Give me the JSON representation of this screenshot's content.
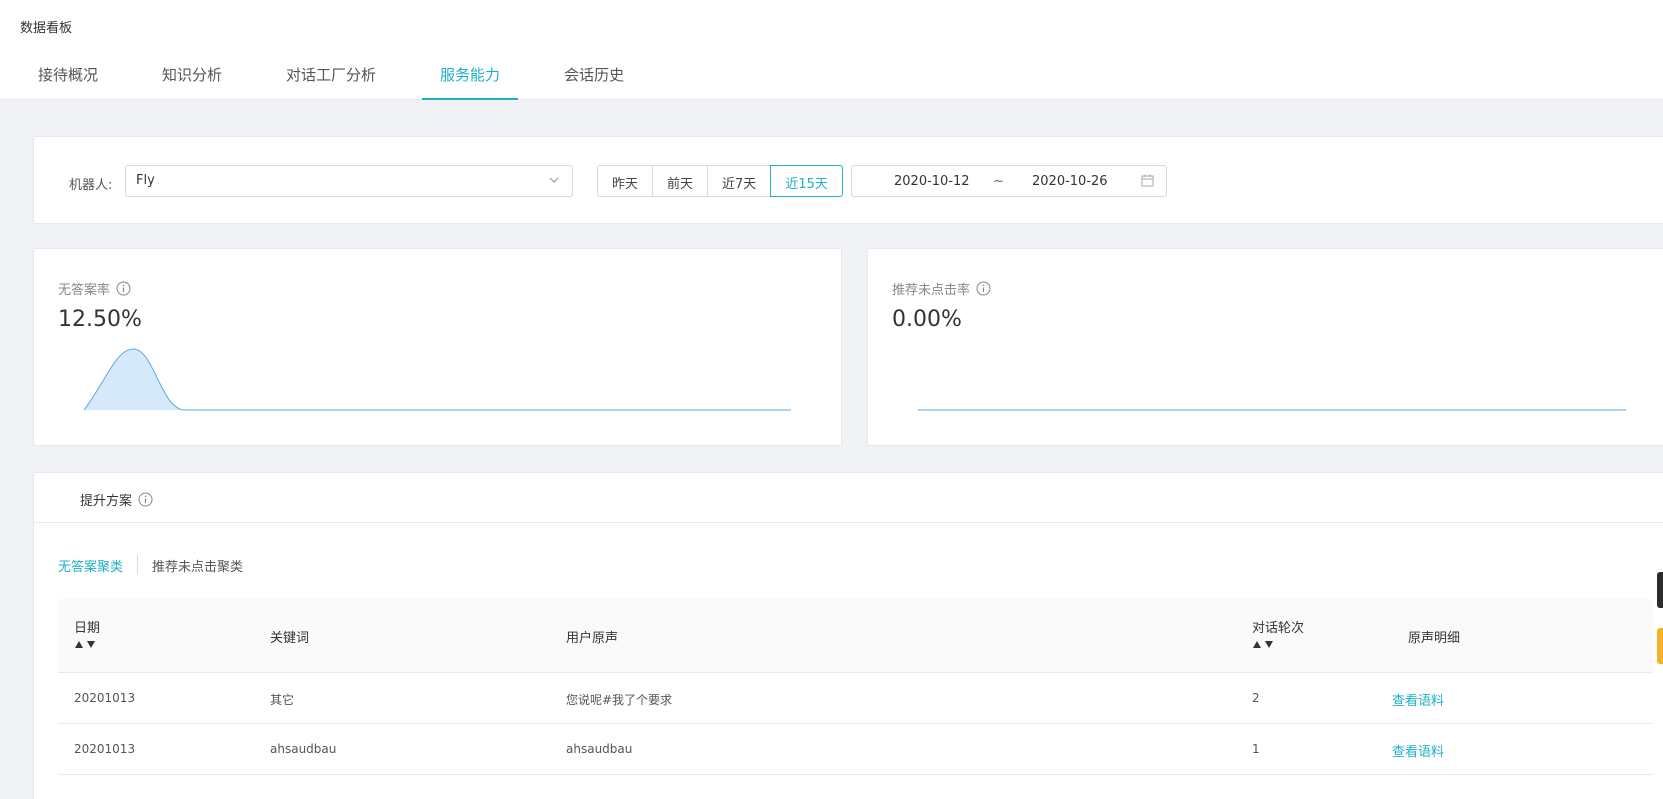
{
  "header": {
    "title": "数据看板",
    "tabs": [
      {
        "label": "接待概况",
        "active": false
      },
      {
        "label": "知识分析",
        "active": false
      },
      {
        "label": "对话工厂分析",
        "active": false
      },
      {
        "label": "服务能力",
        "active": true
      },
      {
        "label": "会话历史",
        "active": false
      }
    ]
  },
  "filters": {
    "bot_label": "机器人:",
    "bot_value": "Fly",
    "ranges": [
      "昨天",
      "前天",
      "近7天",
      "近15天"
    ],
    "active_range": "近15天",
    "date_start": "2020-10-12",
    "date_separator": "~",
    "date_end": "2020-10-26"
  },
  "metrics": [
    {
      "title": "无答案率",
      "value": "12.50%"
    },
    {
      "title": "推荐未点击率",
      "value": "0.00%"
    }
  ],
  "chart_data": [
    {
      "type": "area",
      "series": [
        {
          "values": [
            12.5,
            0,
            0,
            0,
            0,
            0,
            0,
            0,
            0,
            0,
            0,
            0,
            0,
            0,
            0
          ]
        }
      ],
      "ylim": [
        0,
        12.5
      ]
    },
    {
      "type": "area",
      "series": [
        {
          "values": [
            0,
            0,
            0,
            0,
            0,
            0,
            0,
            0,
            0,
            0,
            0,
            0,
            0,
            0,
            0
          ]
        }
      ],
      "ylim": [
        0,
        12.5
      ]
    }
  ],
  "plan": {
    "title": "提升方案",
    "subtabs": [
      {
        "label": "无答案聚类",
        "active": true
      },
      {
        "label": "推荐未点击聚类",
        "active": false
      }
    ],
    "table": {
      "columns": [
        "日期",
        "关键词",
        "用户原声",
        "对话轮次",
        "原声明细"
      ],
      "rows": [
        {
          "date": "20201013",
          "keyword": "其它",
          "voice": "您说呢#我了个要求",
          "turns": "2",
          "action": "查看语料"
        },
        {
          "date": "20201013",
          "keyword": "ahsaudbau",
          "voice": "ahsaudbau",
          "turns": "1",
          "action": "查看语料"
        }
      ]
    }
  },
  "colors": {
    "accent": "#1eb0c7",
    "chart_line": "#5aa9e6",
    "chart_fill": "#d6e9fb"
  }
}
